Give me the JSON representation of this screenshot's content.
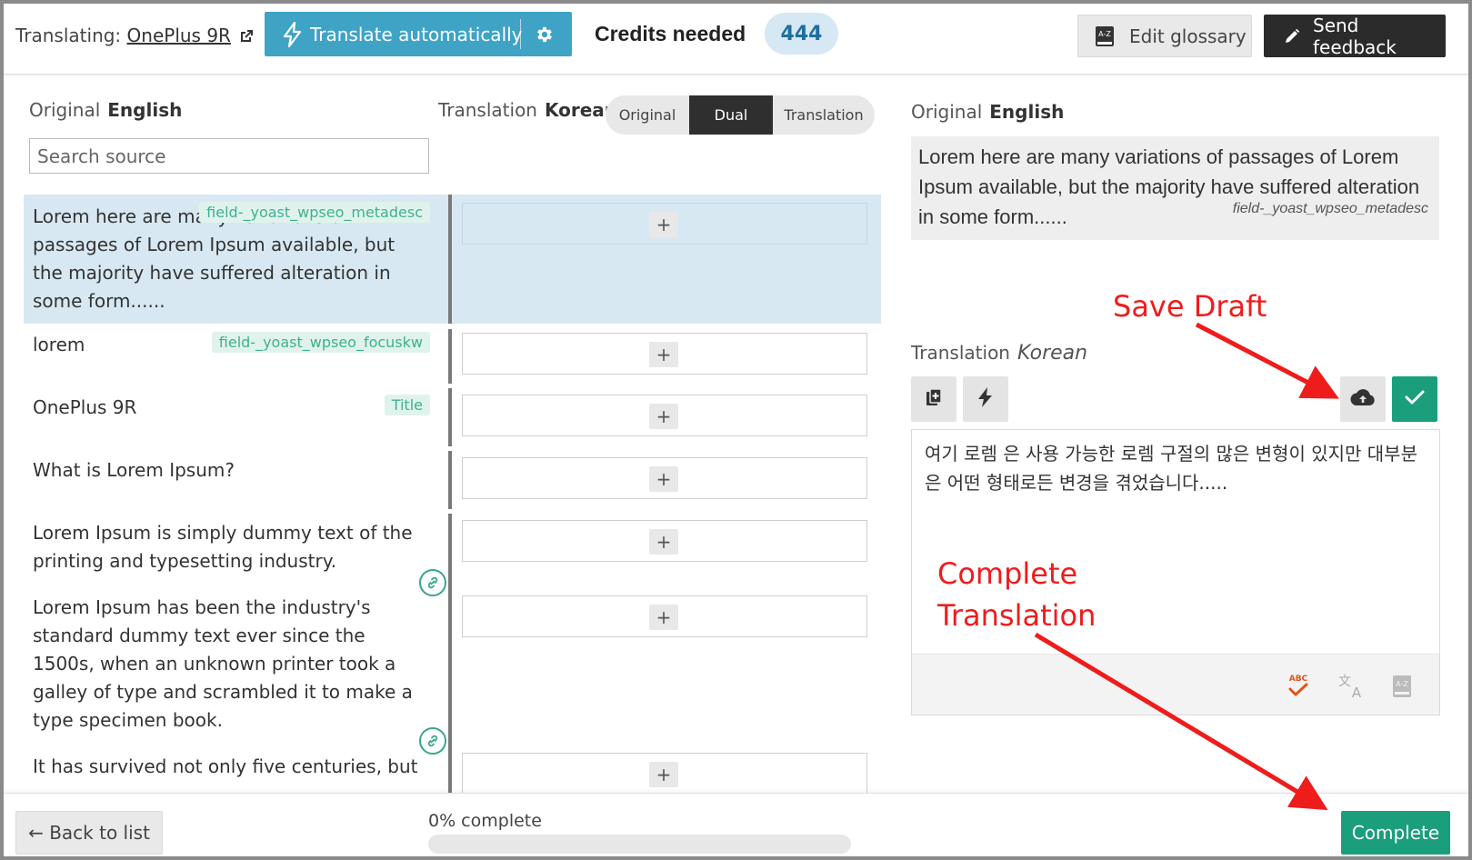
{
  "header": {
    "translating_label": "Translating:",
    "page_link": "OnePlus 9R",
    "auto_translate_label": "Translate automatically",
    "credits_label": "Credits needed",
    "credits_value": "444",
    "glossary_label": "Edit glossary",
    "feedback_label": "Send feedback"
  },
  "left": {
    "original_label": "Original",
    "original_lang": "English",
    "translation_label": "Translation",
    "translation_lang": "Korean",
    "view_modes": [
      "Original",
      "Dual",
      "Translation"
    ],
    "active_view": "Dual",
    "search_placeholder": "Search source"
  },
  "segments": [
    {
      "text": "Lorem here are many variations of passages of Lorem Ipsum available, but the majority have suffered alteration in some form......",
      "tag": "field-_yoast_wpseo_metadesc",
      "selected": true
    },
    {
      "text": "lorem",
      "tag": "field-_yoast_wpseo_focuskw"
    },
    {
      "text": "OnePlus 9R",
      "tag": "Title"
    },
    {
      "text": "What is Lorem Ipsum?",
      "tag": ""
    },
    {
      "text": "Lorem Ipsum is simply dummy text of the printing and typesetting industry.",
      "tag": ""
    },
    {
      "text": "Lorem Ipsum has been the industry's standard dummy text ever since the 1500s, when an unknown printer took a galley of type and scrambled it to make a type specimen book.",
      "tag": ""
    },
    {
      "text": "It has survived not only five centuries, but",
      "tag": ""
    }
  ],
  "editor": {
    "original_label": "Original",
    "original_lang": "English",
    "original_text": "Lorem here are many variations of passages of Lorem Ipsum available, but the majority have suffered alteration in some form......",
    "original_field": "field-_yoast_wpseo_metadesc",
    "translation_label": "Translation",
    "translation_lang": "Korean",
    "translation_text": "여기 로렘 은 사용 가능한 로렘 구절의 많은 변형이 있지만 대부분은 어떤 형태로든 변경을 겪었습니다....."
  },
  "annotations": {
    "save_draft": "Save Draft",
    "complete_translation_line1": "Complete",
    "complete_translation_line2": "Translation"
  },
  "footer": {
    "back_label": "← Back to list",
    "progress_label": "0% complete",
    "progress_fraction": 0,
    "complete_label": "Complete"
  },
  "colors": {
    "accent_blue": "#3fa3c6",
    "accent_green": "#1a9e7c",
    "selected_row": "#d7e8f2",
    "annotation_red": "#ef1c1c"
  }
}
